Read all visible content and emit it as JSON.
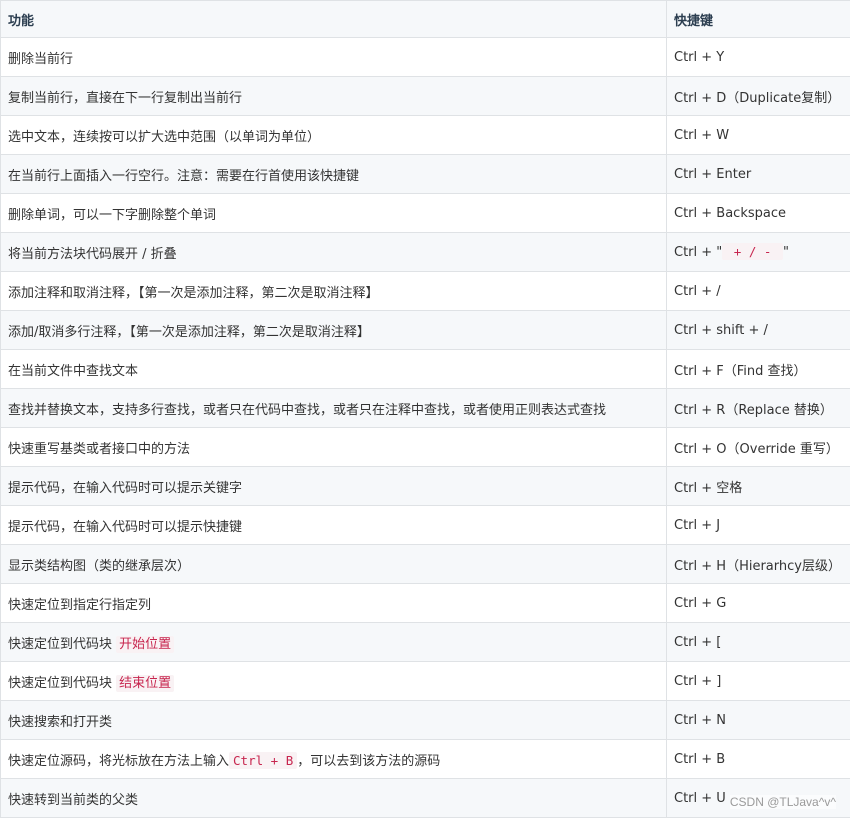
{
  "table": {
    "headers": [
      "功能",
      "快捷键"
    ],
    "rows": [
      {
        "func": "删除当前行",
        "key": "Ctrl + Y"
      },
      {
        "func": "复制当前行，直接在下一行复制出当前行",
        "key": "Ctrl + D（Duplicate复制）"
      },
      {
        "func": "选中文本，连续按可以扩大选中范围（以单词为单位）",
        "key": "Ctrl + W"
      },
      {
        "func": "在当前行上面插入一行空行。注意：需要在行首使用该快捷键",
        "key": "Ctrl + Enter"
      },
      {
        "func": "删除单词，可以一下字删除整个单词",
        "key": "Ctrl + Backspace"
      },
      {
        "func": "将当前方法块代码展开 / 折叠",
        "key_prefix": "Ctrl + \"",
        "key_code": " + / - ",
        "key_suffix": "\""
      },
      {
        "func": "添加注释和取消注释，【第一次是添加注释，第二次是取消注释】",
        "key": "Ctrl + /"
      },
      {
        "func": "添加/取消多行注释，【第一次是添加注释，第二次是取消注释】",
        "key": "Ctrl + shift + /"
      },
      {
        "func": "在当前文件中查找文本",
        "key": "Ctrl + F（Find 查找）"
      },
      {
        "func": "查找并替换文本，支持多行查找，或者只在代码中查找，或者只在注释中查找，或者使用正则表达式查找",
        "key": "Ctrl + R（Replace 替换）"
      },
      {
        "func": "快速重写基类或者接口中的方法",
        "key": "Ctrl + O（Override 重写）"
      },
      {
        "func": "提示代码，在输入代码时可以提示关键字",
        "key": "Ctrl + 空格"
      },
      {
        "func": "提示代码，在输入代码时可以提示快捷键",
        "key": "Ctrl + J"
      },
      {
        "func": "显示类结构图（类的继承层次）",
        "key": "Ctrl + H（Hierarhcy层级）"
      },
      {
        "func": "快速定位到指定行指定列",
        "key": "Ctrl + G"
      },
      {
        "func": "快速定位到代码块 ",
        "func_hl": "开始位置",
        "key": "Ctrl + ["
      },
      {
        "func": "快速定位到代码块 ",
        "func_hl": "结束位置",
        "key": "Ctrl + ]"
      },
      {
        "func": "快速搜索和打开类",
        "key": "Ctrl + N"
      },
      {
        "func": "快速定位源码，将光标放在方法上输入",
        "func_code": "Ctrl + B",
        "func_suffix": "，可以去到该方法的源码",
        "key": "Ctrl + B"
      },
      {
        "func": "快速转到当前类的父类",
        "key": "Ctrl + U"
      }
    ]
  },
  "watermark": "CSDN @TLJava^v^",
  "colors": {
    "code_text": "#c7254e",
    "code_bg": "#f9f2f4",
    "header_bg": "#f6f8fa",
    "border": "#dfe2e5"
  }
}
